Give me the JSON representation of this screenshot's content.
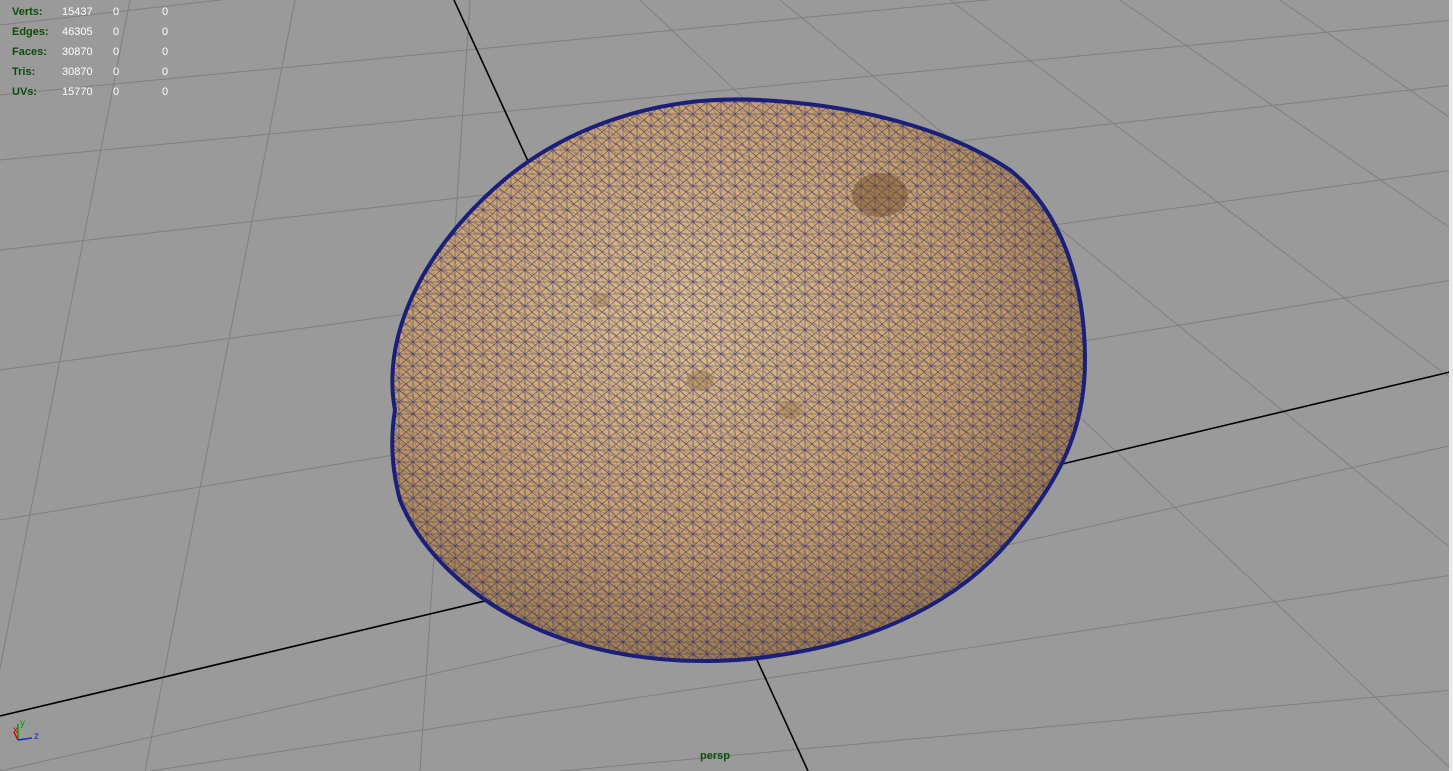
{
  "hud": {
    "rows": [
      {
        "label": "Verts:",
        "c1": "15437",
        "c2": "0",
        "c3": "0"
      },
      {
        "label": "Edges:",
        "c1": "46305",
        "c2": "0",
        "c3": "0"
      },
      {
        "label": "Faces:",
        "c1": "30870",
        "c2": "0",
        "c3": "0"
      },
      {
        "label": "Tris:",
        "c1": "30870",
        "c2": "0",
        "c3": "0"
      },
      {
        "label": "UVs:",
        "c1": "15770",
        "c2": "0",
        "c3": "0"
      }
    ]
  },
  "camera_label": "persp",
  "axis": {
    "x": "x",
    "y": "y",
    "z": "z"
  },
  "colors": {
    "background": "#9a9a9a",
    "grid_line": "#7f7f7f",
    "axis_line": "#000000",
    "wire": "#1a1f7a",
    "skin": "#c9a068",
    "hud_label": "#0b4d0b"
  }
}
